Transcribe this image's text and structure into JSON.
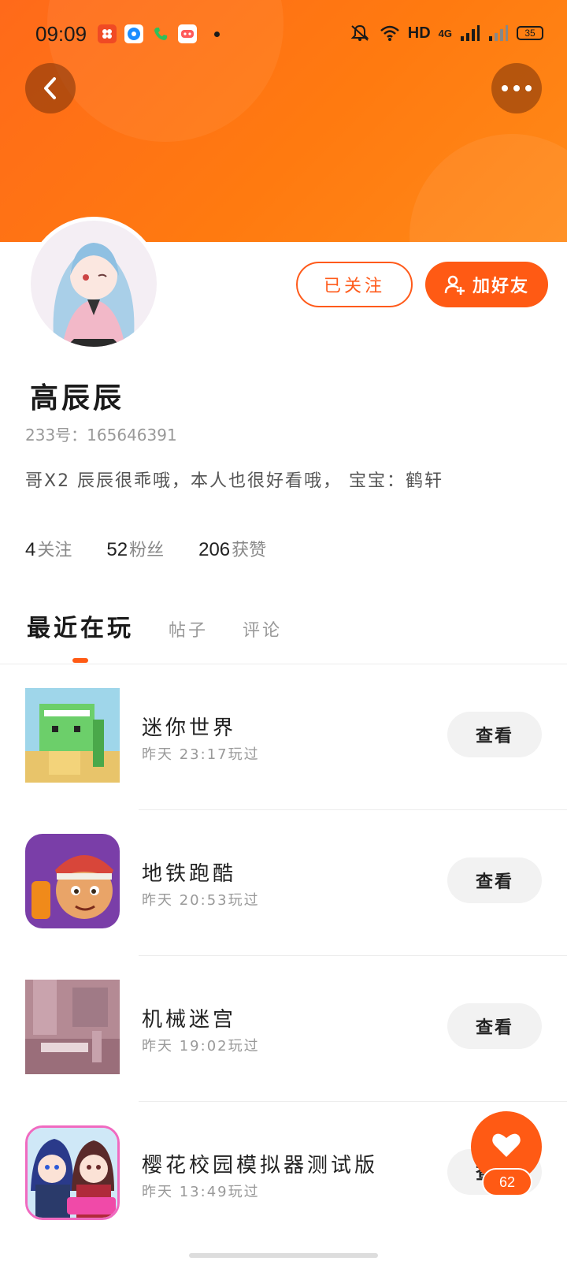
{
  "status_bar": {
    "time": "09:09",
    "network": "HD",
    "cellular": "4G",
    "battery": "35",
    "icons": [
      "notification-app-icon",
      "browser-app-icon",
      "phone-app-icon",
      "game-app-icon",
      "mute-icon",
      "wifi-icon",
      "signal-icon",
      "battery-icon"
    ]
  },
  "header": {
    "back_icon": "chevron-left-icon",
    "more_icon": "more-dots-icon",
    "accent_color": "#ff6a14"
  },
  "profile": {
    "name": "高辰辰",
    "uid": "233号：165646391",
    "bio": "哥X2 辰辰很乖哦，本人也很好看哦， 宝宝：鹤轩",
    "follow_button": "已关注",
    "add_friend_button": "加好友",
    "stats": [
      {
        "num": "4",
        "label": "关注"
      },
      {
        "num": "52",
        "label": "粉丝"
      },
      {
        "num": "206",
        "label": "获赞"
      }
    ]
  },
  "tabs": [
    "最近在玩",
    "帖子",
    "评论"
  ],
  "games": [
    {
      "name": "迷你世界",
      "time": "昨天 23:17玩过",
      "button": "查看"
    },
    {
      "name": "地铁跑酷",
      "time": "昨天 20:53玩过",
      "button": "查看"
    },
    {
      "name": "机械迷宫",
      "time": "昨天 19:02玩过",
      "button": "查看"
    },
    {
      "name": "樱花校园模拟器测试版",
      "time": "昨天 13:49玩过",
      "button": "查看"
    }
  ],
  "fab": {
    "count": "62",
    "icon": "heart-icon"
  }
}
